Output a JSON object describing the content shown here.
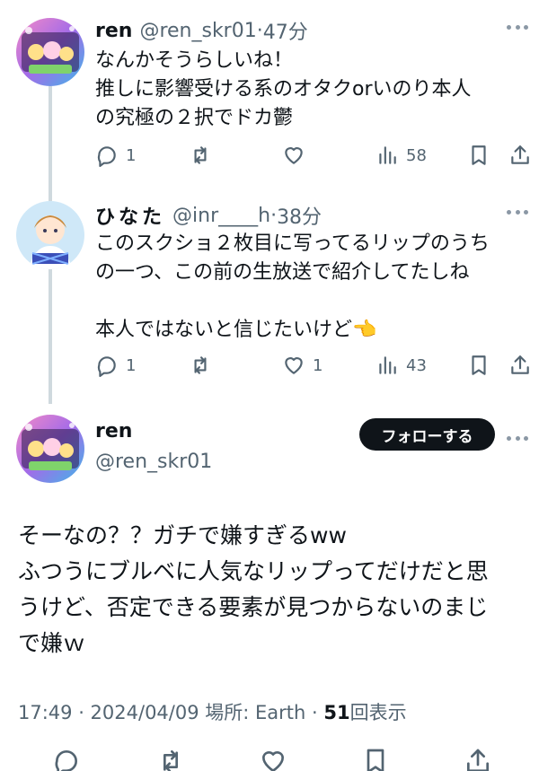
{
  "replies": [
    {
      "name": "ren",
      "handle": "@ren_skr01",
      "time": "47分",
      "text": "なんかそうらしいね！\n推しに影響受ける系のオタクorいのり本人\nの究極の２択でドカ鬱",
      "reply_count": "1",
      "retweet_count": "",
      "like_count": "",
      "view_count": "58"
    },
    {
      "name": "ひなた",
      "handle": "@inr____h",
      "time": "38分",
      "text": "このスクショ２枚目に写ってるリップのうち\nの一つ、この前の生放送で紹介してたしね\n\n本人ではないと信じたいけど👈",
      "reply_count": "1",
      "retweet_count": "",
      "like_count": "1",
      "view_count": "43"
    }
  ],
  "main_tweet": {
    "name": "ren",
    "handle": "@ren_skr01",
    "follow_label": "フォローする",
    "text": "そーなの？？ガチで嫌すぎるww\nふつうにブルベに人気なリップってだけだと思\nうけど、否定できる要素が見つからないのまじ\nで嫌ｗ",
    "timestamp_prefix": "17:49 · 2024/04/09 場所: Earth · ",
    "views": "51",
    "views_suffix": "回表示"
  },
  "colors": {
    "text": "#0f1419",
    "secondary": "#536471",
    "thread_line": "#cfd9de",
    "button_bg": "#0f1419"
  },
  "icons": [
    "reply-icon",
    "retweet-icon",
    "like-icon",
    "views-icon",
    "bookmark-icon",
    "share-icon",
    "more-icon"
  ]
}
